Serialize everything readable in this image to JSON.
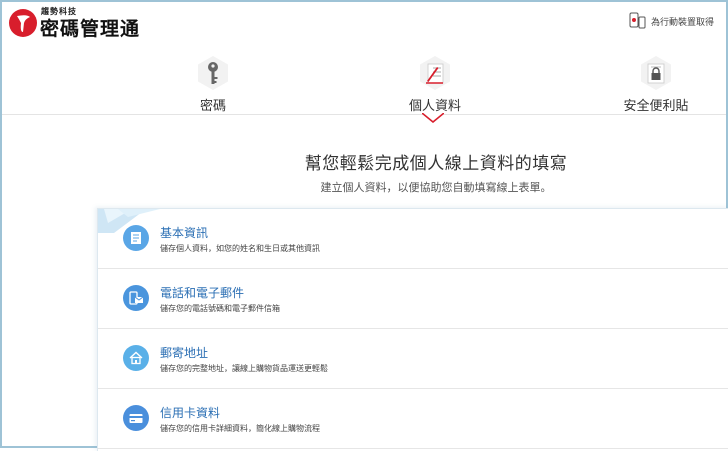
{
  "header": {
    "brand_small": "趨勢科技",
    "brand_title": "密碼管理通",
    "mobile_link": "為行動裝置取得"
  },
  "tabs": [
    {
      "label": "密碼",
      "icon": "key-icon"
    },
    {
      "label": "個人資料",
      "icon": "profile-form-icon",
      "active": true
    },
    {
      "label": "安全便利貼",
      "icon": "secure-note-icon"
    }
  ],
  "hero": {
    "title": "幫您輕鬆完成個人線上資料的填寫",
    "subtitle": "建立個人資料，以便協助您自動填寫線上表單。"
  },
  "categories": [
    {
      "title": "基本資訊",
      "desc": "儲存個人資料，如您的姓名和生日或其他資訊",
      "icon": "id-card-icon"
    },
    {
      "title": "電話和電子郵件",
      "desc": "儲存您的電話號碼和電子郵件信箱",
      "icon": "phone-mail-icon"
    },
    {
      "title": "郵寄地址",
      "desc": "儲存您的完整地址，讓線上購物貨品運送更輕鬆",
      "icon": "home-icon"
    },
    {
      "title": "信用卡資料",
      "desc": "儲存您的信用卡詳細資料，簡化線上購物流程",
      "icon": "credit-card-icon"
    }
  ],
  "colors": {
    "accent_red": "#d81e2c",
    "link_blue": "#2b6fb4",
    "icon_blue": "#4a9be0"
  }
}
